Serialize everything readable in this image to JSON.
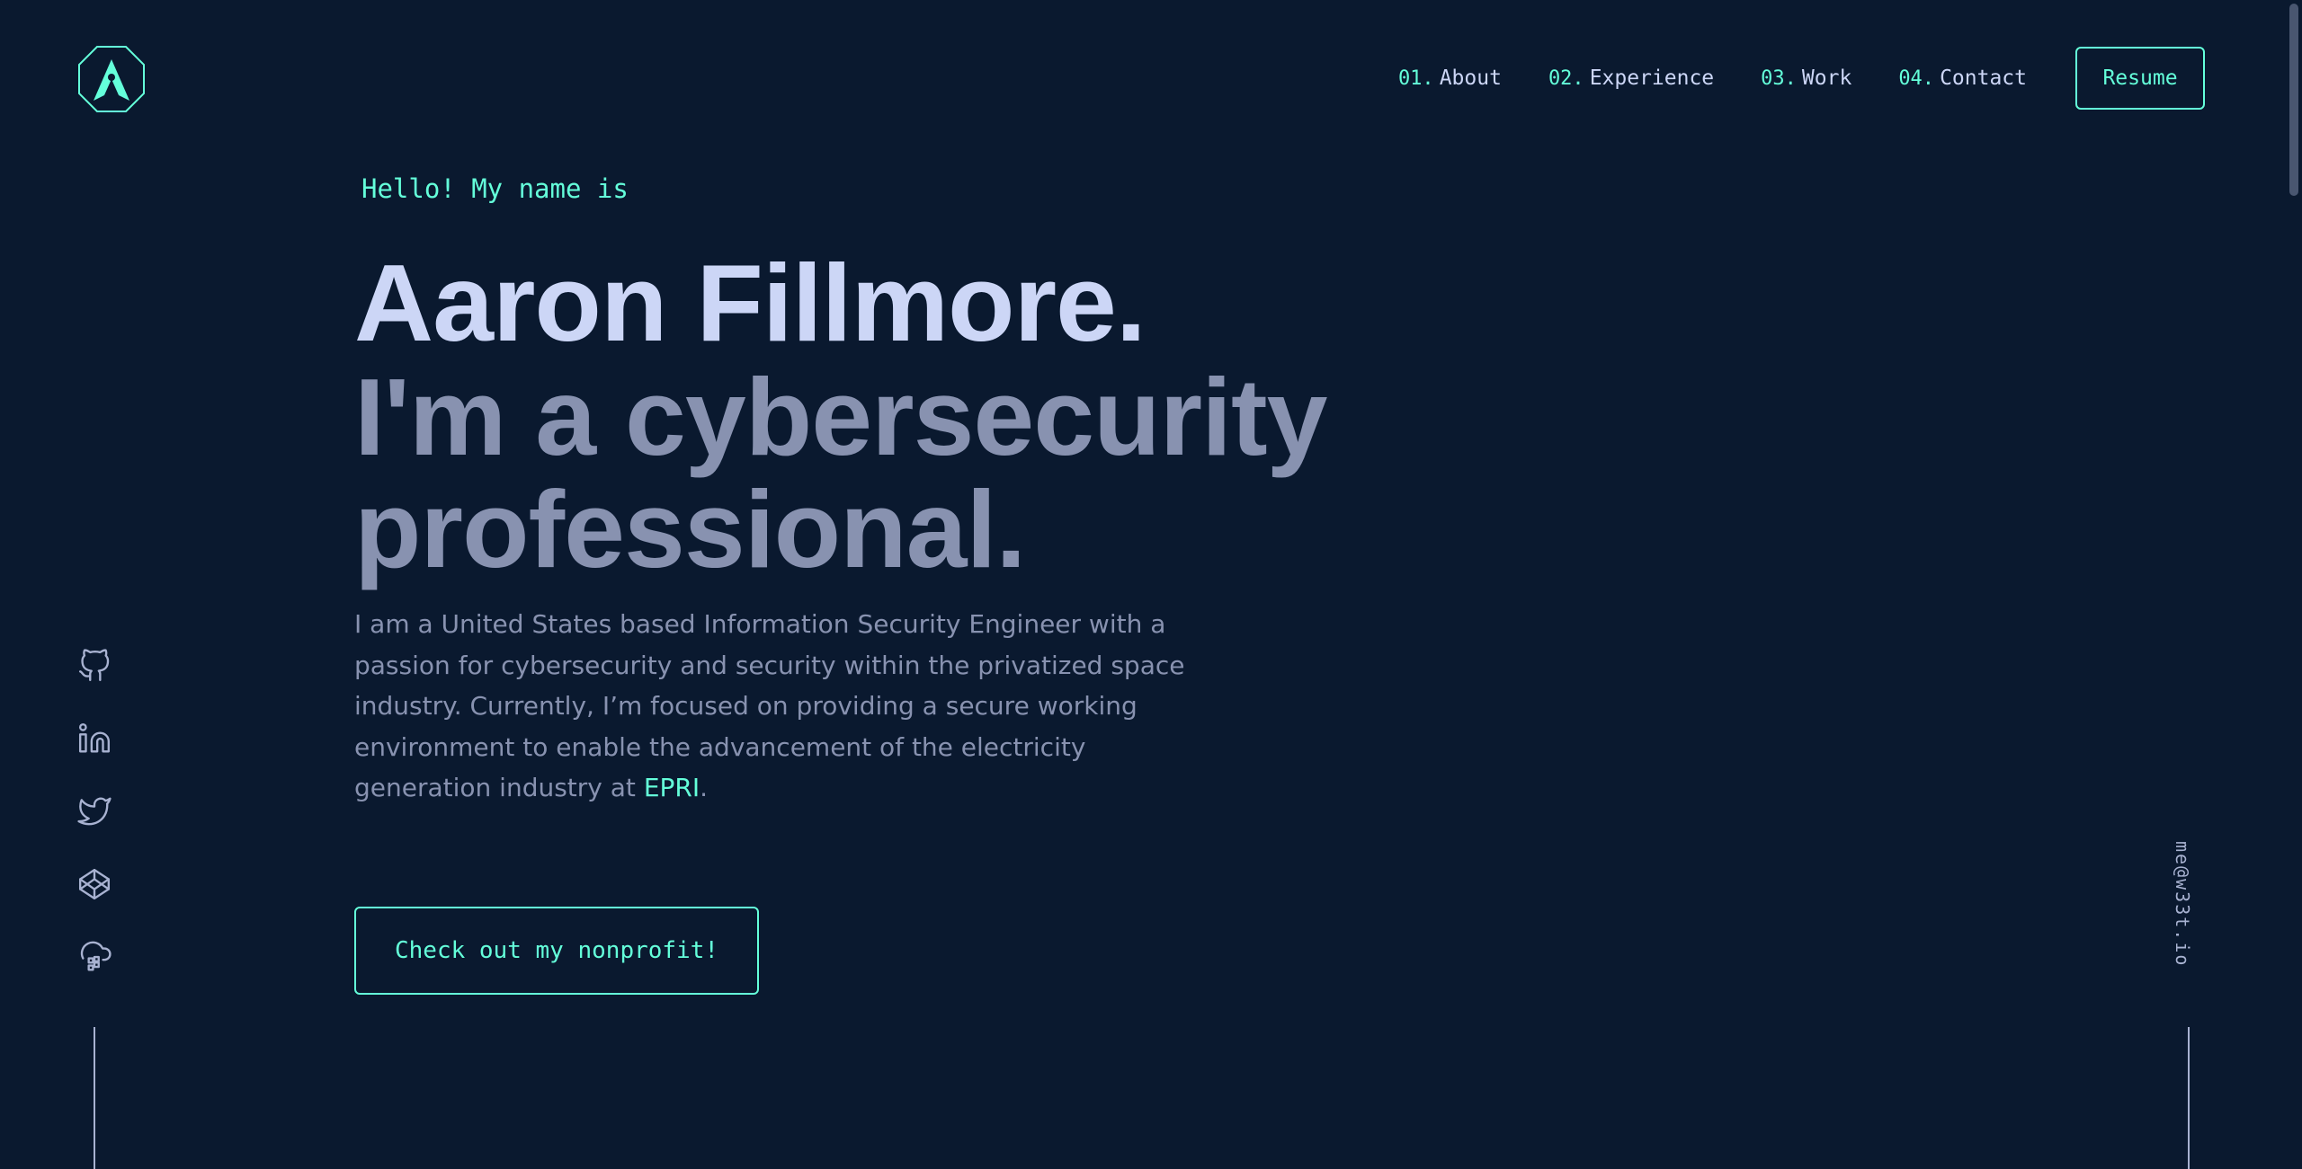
{
  "nav": {
    "items": [
      {
        "num": "01.",
        "label": "About"
      },
      {
        "num": "02.",
        "label": "Experience"
      },
      {
        "num": "03.",
        "label": "Work"
      },
      {
        "num": "04.",
        "label": "Contact"
      }
    ],
    "resume_label": "Resume"
  },
  "logo": {
    "letter": "A"
  },
  "hero": {
    "greeting": "Hello! My name is",
    "name": "Aaron Fillmore.",
    "tagline": "I'm a cybersecurity professional.",
    "bio_before": "I am a United States based Information Security Engineer with a passion for cybersecurity and security within the privatized space industry. Currently, I’m focused on providing a secure working environment to enable the advancement of the electricity generation industry at ",
    "bio_link": "EPRI",
    "bio_after": ".",
    "cta_label": "Check out my nonprofit!"
  },
  "socials": [
    {
      "icon": "github-icon"
    },
    {
      "icon": "linkedin-icon"
    },
    {
      "icon": "twitter-icon"
    },
    {
      "icon": "codepen-icon"
    },
    {
      "icon": "cloud-icon"
    }
  ],
  "email": "me@w33t.io",
  "colors": {
    "background": "#0a192f",
    "accent": "#64ffda",
    "heading": "#ccd6f6",
    "text": "#8892b0"
  }
}
